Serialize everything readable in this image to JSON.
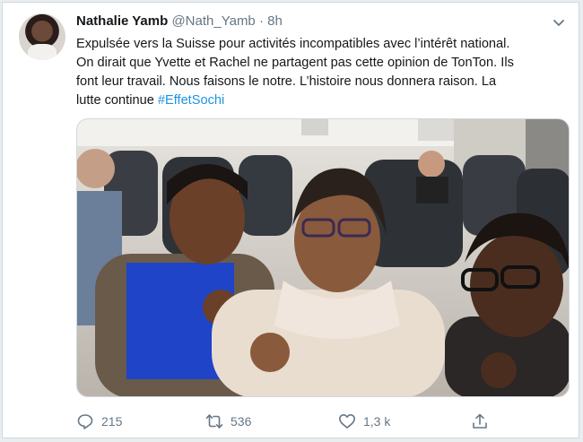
{
  "tweet": {
    "author_name": "Nathalie Yamb",
    "handle": "@Nath_Yamb",
    "separator": "·",
    "time": "8h",
    "text_lines": [
      "Expulsée vers la Suisse pour activités incompatibles avec l’intérêt national.",
      "On dirait que Yvette et Rachel ne partagent pas cette opinion de TonTon. Ils",
      "font leur travail. Nous faisons le notre. L’histoire nous donnera raison. La",
      "lutte continue "
    ],
    "hashtag": "#EffetSochi"
  },
  "actions": {
    "replies": "215",
    "retweets": "536",
    "likes": "1,3 k"
  },
  "icons": {
    "caret": "chevron-down-icon",
    "reply": "reply-icon",
    "retweet": "retweet-icon",
    "like": "heart-icon",
    "share": "share-icon"
  },
  "colors": {
    "text": "#14171a",
    "muted": "#657786",
    "link": "#1b95e0",
    "border": "#cfd9de"
  }
}
